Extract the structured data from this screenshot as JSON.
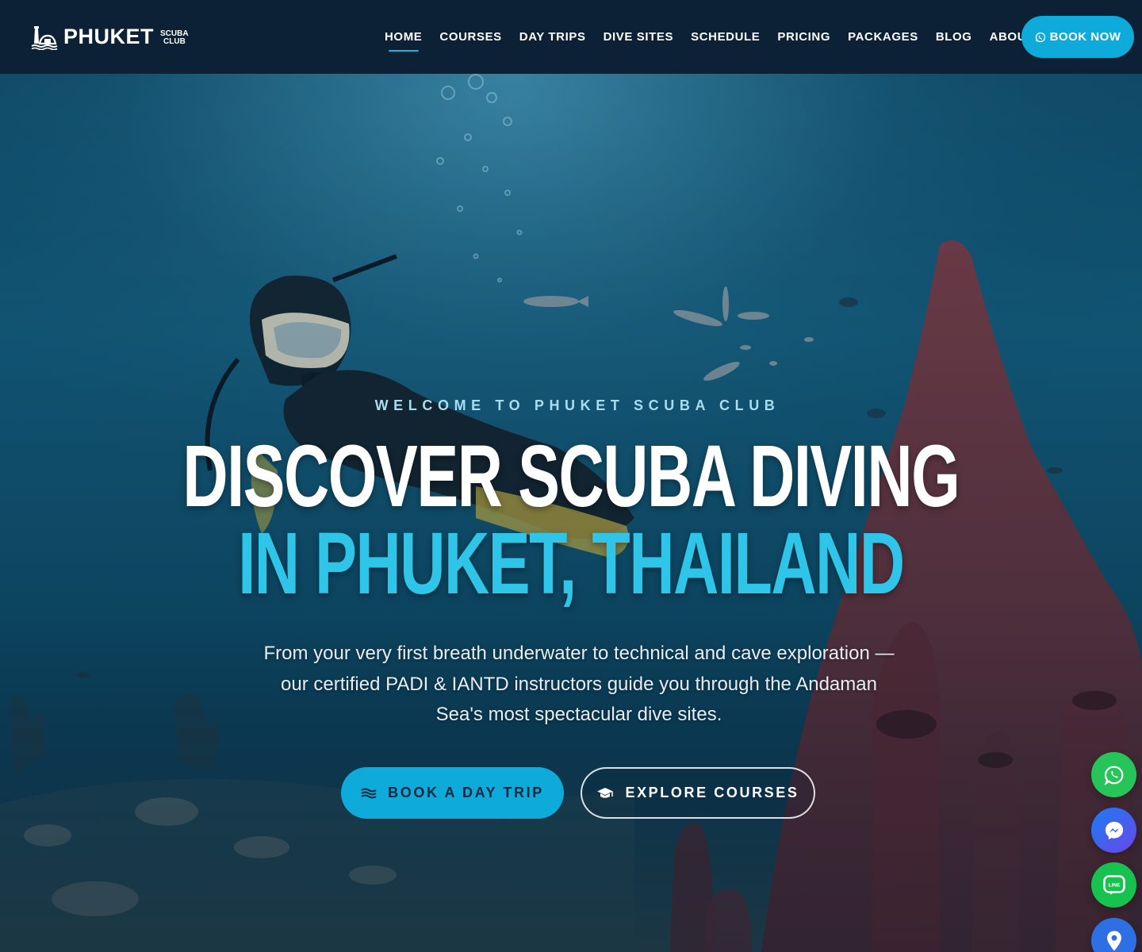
{
  "header": {
    "logo": {
      "main": "PHUKET",
      "sub_top": "SCUBA",
      "sub_bottom": "CLUB"
    },
    "nav": [
      {
        "label": "HOME",
        "active": true
      },
      {
        "label": "COURSES"
      },
      {
        "label": "DAY TRIPS"
      },
      {
        "label": "DIVE SITES"
      },
      {
        "label": "SCHEDULE"
      },
      {
        "label": "PRICING"
      },
      {
        "label": "PACKAGES"
      },
      {
        "label": "BLOG"
      },
      {
        "label": "ABOUT"
      }
    ],
    "cta": {
      "label": "BOOK NOW",
      "icon": "whatsapp-icon"
    }
  },
  "hero": {
    "eyebrow": "WELCOME TO PHUKET SCUBA CLUB",
    "headline_line1": "DISCOVER SCUBA DIVING",
    "headline_line2": "IN PHUKET, THAILAND",
    "description_lines": [
      "From your very first breath underwater to technical and cave exploration —",
      "our certified PADI & IANTD instructors guide you through the Andaman",
      "Sea's most spectacular dive sites."
    ],
    "primary_button": {
      "label": "BOOK A DAY TRIP",
      "icon": "waves-icon"
    },
    "secondary_button": {
      "label": "EXPLORE COURSES",
      "icon": "graduation-cap-icon"
    }
  },
  "floating_contacts": [
    {
      "name": "whatsapp",
      "icon": "whatsapp-icon",
      "color": "#27c45a"
    },
    {
      "name": "messenger",
      "icon": "messenger-icon",
      "color": "#1a7cf3"
    },
    {
      "name": "line",
      "icon": "line-icon",
      "color": "#17c24f"
    },
    {
      "name": "map",
      "icon": "map-pin-icon",
      "color": "#2f6fe4"
    }
  ],
  "colors": {
    "header_bg": "#0c2136",
    "accent": "#0eaad9",
    "headline_accent": "#2ec5e8",
    "eyebrow": "#a9dcef"
  }
}
